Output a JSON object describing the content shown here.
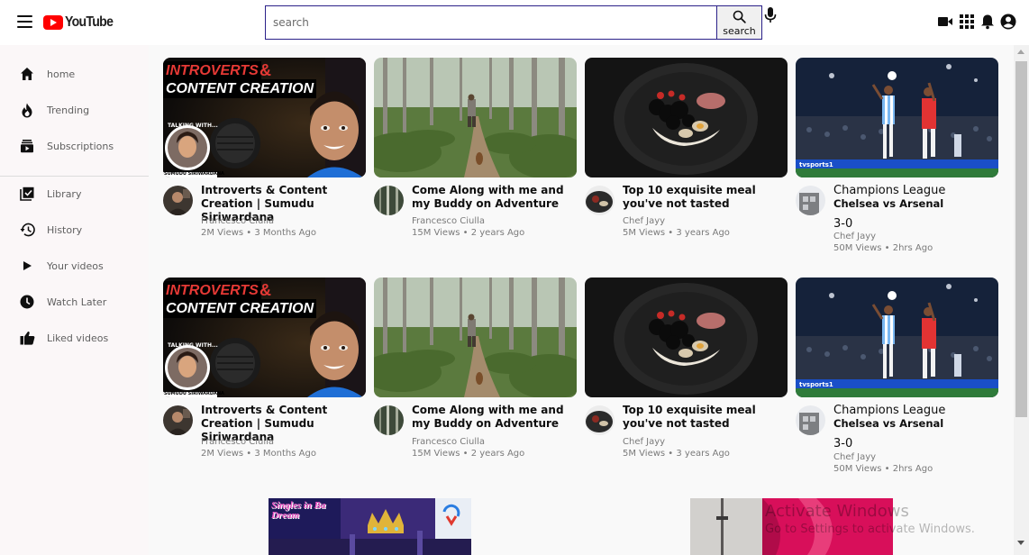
{
  "header": {
    "logo_text": "YouTube",
    "search_placeholder": "search",
    "search_button_label": "search"
  },
  "sidebar": {
    "items": [
      {
        "label": "home",
        "icon": "home-icon"
      },
      {
        "label": "Trending",
        "icon": "fire-icon"
      },
      {
        "label": "Subscriptions",
        "icon": "subscriptions-icon"
      },
      {
        "label": "Library",
        "icon": "library-icon"
      },
      {
        "label": "History",
        "icon": "history-icon"
      },
      {
        "label": "Your videos",
        "icon": "play-icon"
      },
      {
        "label": "Watch Later",
        "icon": "clock-icon"
      },
      {
        "label": "Liked videos",
        "icon": "thumbs-up-icon"
      }
    ]
  },
  "videos": [
    {
      "title": "Introverts & Content Creation | Sumudu Siriwardana",
      "channel": "Francesco Ciulla",
      "meta": "2M Views • 3 Months Ago",
      "thumb_text_1": "INTROVERTS",
      "thumb_text_2": "CONTENT CREATION",
      "thumb_text_3": "TALKING WITH...",
      "thumb_text_4": "SUMUDU SIRIWARDANA"
    },
    {
      "title": "Come Along with me and my Buddy on Adventure",
      "channel": "Francesco Ciulla",
      "meta": "15M Views • 2 years Ago"
    },
    {
      "title": "Top 10 exquisite meal you've not tasted",
      "channel": "Chef Jayy",
      "meta": "5M Views • 3 years Ago"
    },
    {
      "title": "Champions League",
      "subtitle": "Chelsea vs Arsenal",
      "score": "3-0",
      "channel": "Chef Jayy",
      "meta": "50M Views • 2hrs Ago",
      "thumb_text": "tvsports1"
    }
  ],
  "banners": {
    "left_text": "Singles in Ba Dream"
  },
  "watermark": {
    "line1": "Activate Windows",
    "line2": "Go to Settings to activate Windows."
  },
  "colors": {
    "brand_red": "#ff0000",
    "search_border": "#2b2189",
    "sidebar_bg": "#fbf7f8",
    "page_bg": "#f9f9f9"
  }
}
